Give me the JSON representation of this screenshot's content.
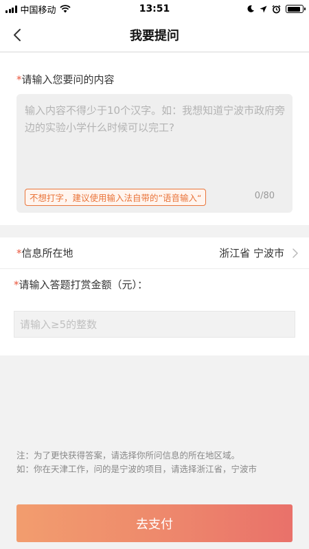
{
  "status_bar": {
    "carrier": "中国移动",
    "time": "13:51",
    "battery_level": 0.9
  },
  "nav": {
    "title": "我要提问"
  },
  "question": {
    "required_mark": "*",
    "label": "请输入您要问的内容",
    "placeholder": "输入内容不得少于10个汉字。如：我想知道宁波市政府旁边的实验小学什么时候可以完工?",
    "voice_tip": "不想打字，建议使用输入法自带的”语音输入“",
    "char_count": "0/80"
  },
  "location": {
    "required_mark": "*",
    "label": "信息所在地",
    "value": "浙江省 宁波市"
  },
  "reward": {
    "required_mark": "*",
    "label": "请输入答题打赏金额（元）：",
    "placeholder": "请输入≥5的整数"
  },
  "notes": {
    "line1": "注：为了更快获得答案，请选择你所问信息的所在地区域。",
    "line2": "如：你在天津工作，问的是宁波的项目，请选择浙江省，宁波市"
  },
  "actions": {
    "pay_label": "去支付"
  },
  "colors": {
    "accent": "#e9743a",
    "required": "#e9583f",
    "pay_gradient_start": "#f29d6e",
    "pay_gradient_end": "#e9716a"
  }
}
